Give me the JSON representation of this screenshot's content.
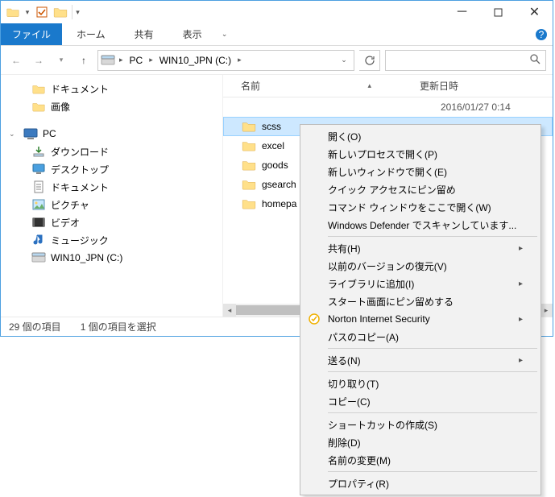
{
  "titlebar": {},
  "ribbon": {
    "file": "ファイル",
    "home": "ホーム",
    "share": "共有",
    "view": "表示"
  },
  "address": {
    "pc": "PC",
    "drive": "WIN10_JPN (C:)"
  },
  "search": {
    "icon": "🔍"
  },
  "tree": {
    "documents_link": "ドキュメント",
    "images_link": "画像",
    "pc": "PC",
    "downloads": "ダウンロード",
    "desktop": "デスクトップ",
    "documents": "ドキュメント",
    "pictures": "ピクチャ",
    "videos": "ビデオ",
    "music": "ミュージック",
    "drive": "WIN10_JPN (C:)"
  },
  "columns": {
    "name": "名前",
    "date": "更新日時"
  },
  "files": [
    {
      "name": "scss",
      "date": "2016/01/27 0:14",
      "selected": true
    },
    {
      "name": "excel",
      "date": ""
    },
    {
      "name": "goods",
      "date": ""
    },
    {
      "name": "gsearch",
      "date": ""
    },
    {
      "name": "homepa",
      "date": ""
    }
  ],
  "status": {
    "count": "29 個の項目",
    "selection": "1 個の項目を選択"
  },
  "ctx": [
    {
      "label": "開く(O)"
    },
    {
      "label": "新しいプロセスで開く(P)"
    },
    {
      "label": "新しいウィンドウで開く(E)"
    },
    {
      "label": "クイック アクセスにピン留め"
    },
    {
      "label": "コマンド ウィンドウをここで開く(W)"
    },
    {
      "label": "Windows Defender でスキャンしています..."
    },
    {
      "sep": true
    },
    {
      "label": "共有(H)",
      "sub": true
    },
    {
      "label": "以前のバージョンの復元(V)"
    },
    {
      "label": "ライブラリに追加(I)",
      "sub": true
    },
    {
      "label": "スタート画面にピン留めする"
    },
    {
      "label": "Norton Internet Security",
      "icon": "norton",
      "sub": true
    },
    {
      "label": "パスのコピー(A)"
    },
    {
      "sep": true
    },
    {
      "label": "送る(N)",
      "sub": true
    },
    {
      "sep": true
    },
    {
      "label": "切り取り(T)"
    },
    {
      "label": "コピー(C)"
    },
    {
      "sep": true
    },
    {
      "label": "ショートカットの作成(S)"
    },
    {
      "label": "削除(D)"
    },
    {
      "label": "名前の変更(M)"
    },
    {
      "sep": true
    },
    {
      "label": "プロパティ(R)"
    }
  ]
}
